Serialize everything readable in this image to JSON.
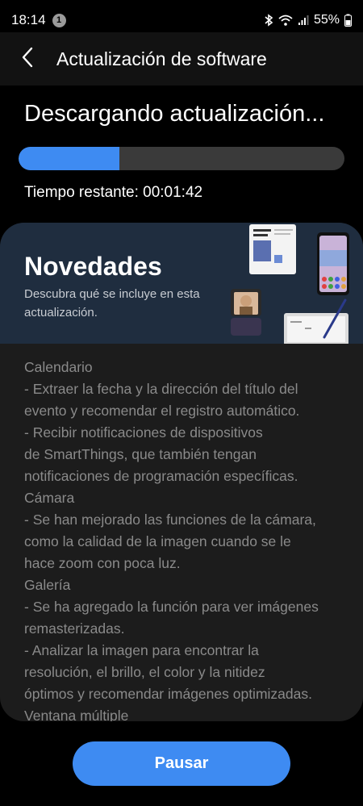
{
  "status_bar": {
    "time": "18:14",
    "notification_count": "1",
    "battery": "55%"
  },
  "header": {
    "title": "Actualización de software",
    "back_icon": "chevron-left-icon"
  },
  "download": {
    "title": "Descargando actualización...",
    "progress_fraction": 0.31,
    "time_remaining": "Tiempo restante: 00:01:42"
  },
  "news_card": {
    "title": "Novedades",
    "subtitle": "Descubra qué se incluye en esta actualización.",
    "illustration_icon": "device-showcase-illustration",
    "notes": [
      "Calendario",
      " - Extraer la fecha y la dirección del título del",
      "evento y recomendar el registro automático.",
      " - Recibir notificaciones de dispositivos",
      "de SmartThings, que también tengan",
      "notificaciones de programación específicas.",
      "Cámara",
      " - Se han mejorado las funciones de la cámara,",
      "como la calidad de la imagen cuando se le",
      "hace zoom con poca luz.",
      "Galería",
      " - Se ha agregado la función para ver imágenes",
      "remasterizadas.",
      " - Analizar la imagen para encontrar la",
      "resolución, el brillo, el color y la nitidez",
      "óptimos y recomendar imágenes optimizadas.",
      "Ventana múltiple"
    ]
  },
  "actions": {
    "pause_label": "Pausar"
  },
  "colors": {
    "accent": "#3e8bf2",
    "progress_track": "#3a3a3a",
    "card_background": "#1c1c1c",
    "banner_background": "#1f2d3f"
  }
}
